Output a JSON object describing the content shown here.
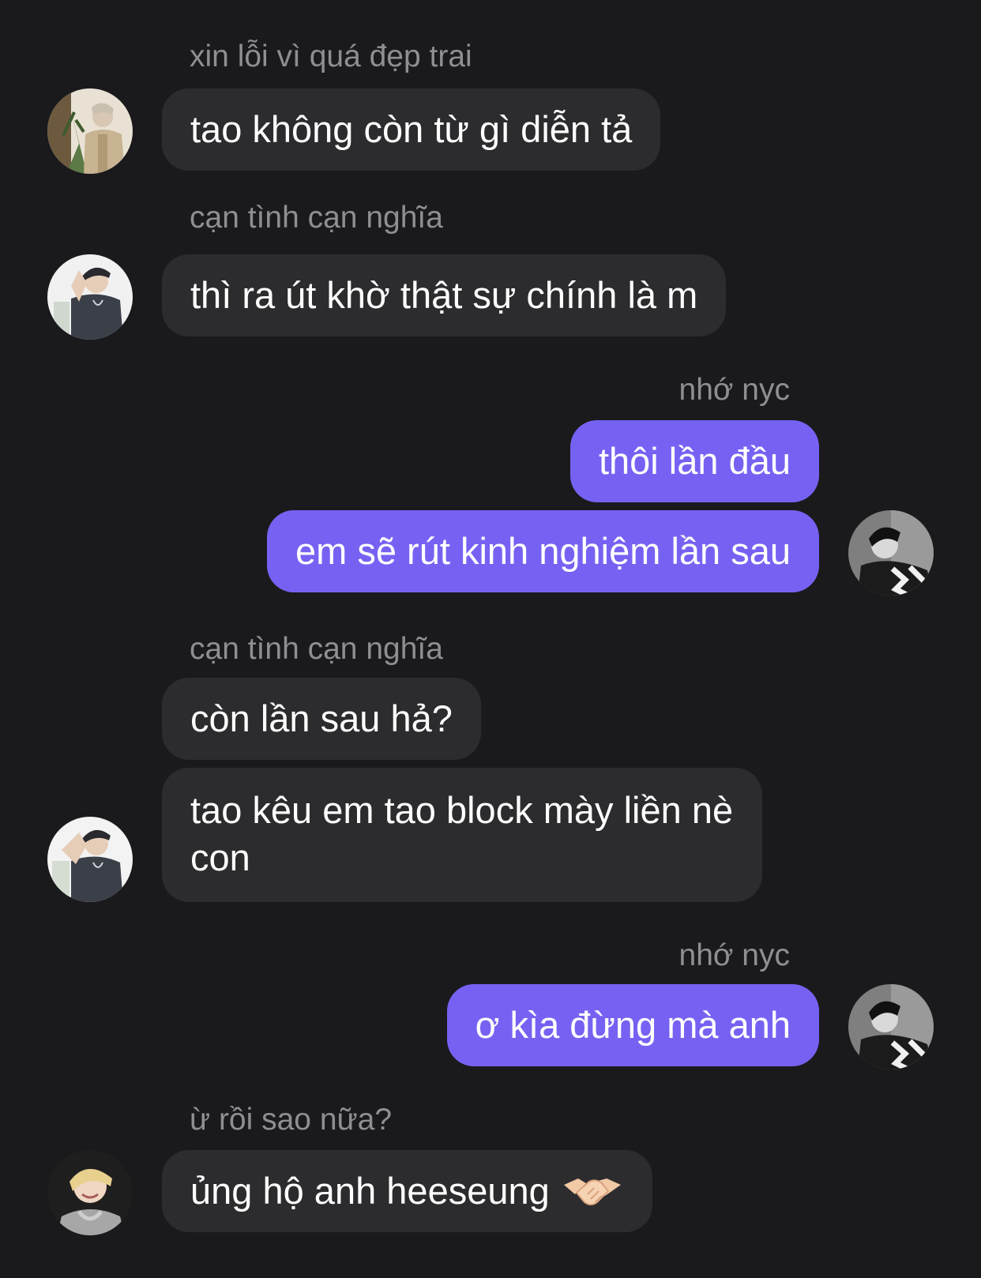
{
  "messages": [
    {
      "sender": "xin lỗi vì quá đẹp trai",
      "text": "tao không còn từ gì diễn tả",
      "side": "incoming"
    },
    {
      "sender": "cạn tình cạn nghĩa",
      "text": "thì ra út khờ thật sự chính là m",
      "side": "incoming"
    },
    {
      "sender": "nhớ nyc",
      "texts": [
        "thôi lần đầu",
        "em sẽ rút kinh nghiệm lần sau"
      ],
      "side": "outgoing"
    },
    {
      "sender": "cạn tình cạn nghĩa",
      "texts": [
        "còn lần sau hả?",
        "tao kêu em tao block mày liền nè con"
      ],
      "side": "incoming"
    },
    {
      "sender": "nhớ nyc",
      "text": "ơ kìa đừng mà anh",
      "side": "outgoing"
    },
    {
      "sender": "ừ rồi sao nữa?",
      "text": "ủng hộ anh heeseung",
      "emoji": "handshake-icon",
      "side": "incoming"
    }
  ],
  "colors": {
    "background": "#1a1a1d",
    "incoming_bubble": "#2c2c2f",
    "outgoing_bubble": "#7662f2",
    "sender_name": "#8e8e93",
    "text": "#ffffff"
  }
}
